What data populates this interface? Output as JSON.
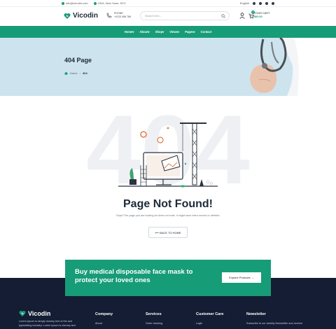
{
  "topbar": {
    "email": "info@vicodin.com",
    "address": "2345, New Yowe, NYC",
    "language": "English"
  },
  "header": {
    "logo": "Vicodin",
    "phone_label": "PHONE",
    "phone_number": "+0123 456 789",
    "search_placeholder": "Search here...",
    "cart_label": "YOUR CART",
    "cart_amount": "$60.00",
    "cart_count": "0"
  },
  "nav": {
    "items": [
      "Home▾",
      "About▾",
      "Shop▾",
      "Views▾",
      "Pages▾",
      "Contact"
    ]
  },
  "banner": {
    "title": "404 Page",
    "crumb_home": "Home",
    "crumb_sep": "›",
    "crumb_current": "404"
  },
  "notfound": {
    "big_number": "404",
    "title": "Page Not Found!",
    "text": "Oops! The page you are looking for does not exist. It might have been moved or deleted.",
    "button": "⟵ BACK TO HOME"
  },
  "promo": {
    "text": "Buy medical disposable face mask to protect your loved ones",
    "button": "Explore Products  →"
  },
  "footer": {
    "logo": "Vicodin",
    "desc": "Lorem ipsum is simply dummy text of the and typesetting industry. Lorem ipsum is dummy text",
    "columns": [
      {
        "heading": "Company",
        "link": "About"
      },
      {
        "heading": "Services",
        "link": "Order tracking"
      },
      {
        "heading": "Customer Care",
        "link": "Login"
      },
      {
        "heading": "Newsletter",
        "link": "Subscribe to our weekly Newsletter and receive"
      }
    ]
  },
  "colors": {
    "brand": "#179c78",
    "banner_bg": "#cde4ee",
    "footer_bg": "#141d34"
  }
}
